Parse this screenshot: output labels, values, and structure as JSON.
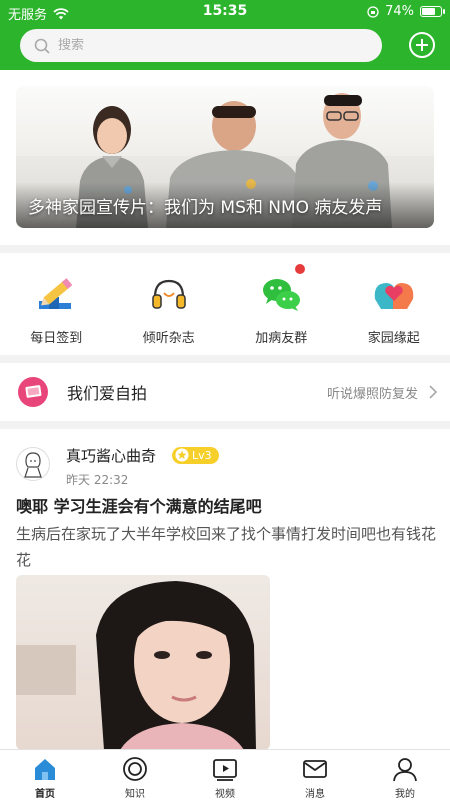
{
  "status_bar": {
    "carrier": "无服务",
    "time": "15:35",
    "battery_percent": "74%",
    "battery_level": 0.74
  },
  "search": {
    "placeholder": "搜索"
  },
  "banner": {
    "caption": "多神家园宣传片：我们为 MS和 NMO 病友发声"
  },
  "quick_nav": [
    {
      "label": "每日签到",
      "icon": "pencil-checkin-icon"
    },
    {
      "label": "倾听杂志",
      "icon": "headphones-icon"
    },
    {
      "label": "加病友群",
      "icon": "chat-bubbles-icon",
      "badge": true
    },
    {
      "label": "家园缘起",
      "icon": "hearts-heads-icon"
    }
  ],
  "topic_row": {
    "title": "我们爱自拍",
    "subtitle": "听说爆照防复发",
    "icon": "photo-icon"
  },
  "post": {
    "author": "真巧酱心曲奇",
    "level": "Lv3",
    "time": "昨天 22:32",
    "title": "噢耶  学习生涯会有个满意的结尾吧",
    "body": "生病后在家玩了大半年学校回来了找个事情打发时间吧也有钱花花"
  },
  "tabs": [
    {
      "label": "首页",
      "icon": "home-icon",
      "active": true
    },
    {
      "label": "知识",
      "icon": "circle-icon",
      "active": false
    },
    {
      "label": "视频",
      "icon": "video-icon",
      "active": false
    },
    {
      "label": "消息",
      "icon": "mail-icon",
      "active": false
    },
    {
      "label": "我的",
      "icon": "person-icon",
      "active": false
    }
  ],
  "colors": {
    "brand_green": "#2cb52c",
    "badge_red": "#e53b3b",
    "level_yellow": "#f7cf2a"
  }
}
